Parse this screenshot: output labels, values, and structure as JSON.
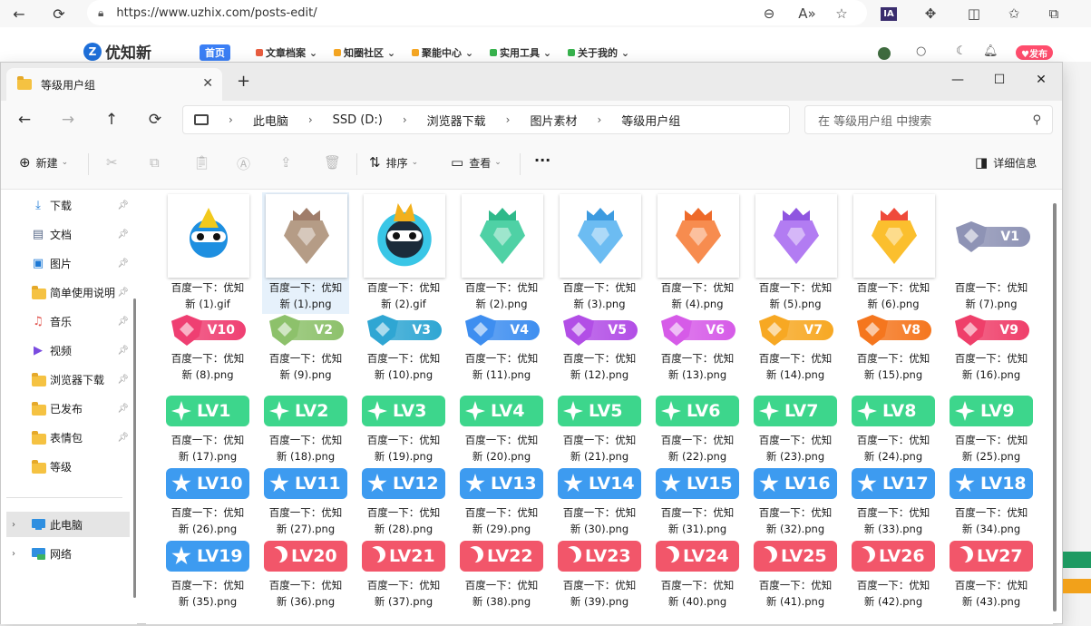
{
  "browser": {
    "url": "https://www.uzhix.com/posts-edit/",
    "buttons": [
      "back-icon",
      "refresh-icon"
    ],
    "right_icons": [
      "zoom-icon",
      "read-aloud-icon",
      "favorite-icon",
      "extension-ia-icon",
      "puzzle-icon",
      "split-screen-icon",
      "favorites-list-icon",
      "collections-icon"
    ]
  },
  "site": {
    "logo": "优知新",
    "logo_mark": "Z",
    "nav": [
      {
        "label": "首页",
        "color": "#3b7ff5"
      },
      {
        "label": "文章档案 ⌄",
        "color": "#e85d3f"
      },
      {
        "label": "知圈社区 ⌄",
        "color": "#f5a623"
      },
      {
        "label": "聚能中心 ⌄",
        "color": "#f5a623"
      },
      {
        "label": "实用工具 ⌄",
        "color": "#37b24d"
      },
      {
        "label": "关于我的 ⌄",
        "color": "#37b24d"
      }
    ],
    "publish": "♥发布"
  },
  "explorer": {
    "tab_title": "等级用户组",
    "tab_add": "+",
    "window_buttons": {
      "min": "—",
      "max": "☐",
      "close": "✕"
    },
    "breadcrumb": [
      "此电脑",
      "SSD (D:)",
      "浏览器下载",
      "图片素材",
      "等级用户组"
    ],
    "breadcrumb_sep": "›",
    "search_placeholder": "在 等级用户组 中搜索",
    "commands": {
      "new": "新建",
      "sort": "排序",
      "view": "查看",
      "more": "···",
      "details": "详细信息"
    },
    "sidebar": [
      {
        "label": "下载",
        "icon": "download-icon",
        "pinned": true
      },
      {
        "label": "文档",
        "icon": "document-icon",
        "pinned": true
      },
      {
        "label": "图片",
        "icon": "picture-icon",
        "pinned": true
      },
      {
        "label": "简单使用说明",
        "icon": "folder-icon",
        "pinned": true
      },
      {
        "label": "音乐",
        "icon": "music-icon",
        "pinned": true
      },
      {
        "label": "视频",
        "icon": "video-icon",
        "pinned": true
      },
      {
        "label": "浏览器下载",
        "icon": "folder-icon",
        "pinned": true
      },
      {
        "label": "已发布",
        "icon": "folder-icon",
        "pinned": true
      },
      {
        "label": "表情包",
        "icon": "folder-icon",
        "pinned": true
      },
      {
        "label": "等级",
        "icon": "folder-icon",
        "pinned": false
      }
    ],
    "sidebar_tree": [
      {
        "label": "此电脑",
        "icon": "computer-icon",
        "active": true
      },
      {
        "label": "网络",
        "icon": "network-icon",
        "active": false
      }
    ],
    "files": [
      {
        "line1": "百度一下：优知",
        "line2": "新 (1).gif",
        "kind": "mascot-white"
      },
      {
        "line1": "百度一下：优知",
        "line2": "新 (1).png",
        "kind": "crown",
        "color": "#b59c86",
        "crown": "#a07d6a"
      },
      {
        "line1": "百度一下：优知",
        "line2": "新 (2).gif",
        "kind": "mascot-dark"
      },
      {
        "line1": "百度一下：优知",
        "line2": "新 (2).png",
        "kind": "crown",
        "color": "#4fd1a5",
        "crown": "#2fb98a"
      },
      {
        "line1": "百度一下：优知",
        "line2": "新 (3).png",
        "kind": "crown",
        "color": "#6cbcf2",
        "crown": "#3d9be0"
      },
      {
        "line1": "百度一下：优知",
        "line2": "新 (4).png",
        "kind": "crown",
        "color": "#f78c4f",
        "crown": "#ee6a2a"
      },
      {
        "line1": "百度一下：优知",
        "line2": "新 (5).png",
        "kind": "crown",
        "color": "#b27cf2",
        "crown": "#8f55e0"
      },
      {
        "line1": "百度一下：优知",
        "line2": "新 (6).png",
        "kind": "crown",
        "color": "#fbbf2e",
        "crown": "#ef4a3a"
      },
      {
        "line1": "百度一下：优知",
        "line2": "新 (7).png",
        "kind": "v",
        "text": "V1",
        "color": "#8e93b5"
      },
      {
        "line1": "百度一下：优知",
        "line2": "新 (8).png",
        "kind": "v",
        "text": "V10",
        "color": "#ef3f72"
      },
      {
        "line1": "百度一下：优知",
        "line2": "新 (9).png",
        "kind": "v",
        "text": "V2",
        "color": "#8dc16b"
      },
      {
        "line1": "百度一下：优知",
        "line2": "新 (10).png",
        "kind": "v",
        "text": "V3",
        "color": "#2fa6d3"
      },
      {
        "line1": "百度一下：优知",
        "line2": "新 (11).png",
        "kind": "v",
        "text": "V4",
        "color": "#3e8ef0"
      },
      {
        "line1": "百度一下：优知",
        "line2": "新 (12).png",
        "kind": "v",
        "text": "V5",
        "color": "#b24ee6"
      },
      {
        "line1": "百度一下：优知",
        "line2": "新 (13).png",
        "kind": "v",
        "text": "V6",
        "color": "#d65be8"
      },
      {
        "line1": "百度一下：优知",
        "line2": "新 (14).png",
        "kind": "v",
        "text": "V7",
        "color": "#f7a823"
      },
      {
        "line1": "百度一下：优知",
        "line2": "新 (15).png",
        "kind": "v",
        "text": "V8",
        "color": "#f5761e"
      },
      {
        "line1": "百度一下：优知",
        "line2": "新 (16).png",
        "kind": "v",
        "text": "V9",
        "color": "#ef3f6a"
      },
      {
        "line1": "百度一下：优知",
        "line2": "新 (17).png",
        "kind": "lv",
        "text": "LV1",
        "color": "#3dd68c",
        "icon": "star4"
      },
      {
        "line1": "百度一下：优知",
        "line2": "新 (18).png",
        "kind": "lv",
        "text": "LV2",
        "color": "#3dd68c",
        "icon": "star4"
      },
      {
        "line1": "百度一下：优知",
        "line2": "新 (19).png",
        "kind": "lv",
        "text": "LV3",
        "color": "#3dd68c",
        "icon": "star4"
      },
      {
        "line1": "百度一下：优知",
        "line2": "新 (20).png",
        "kind": "lv",
        "text": "LV4",
        "color": "#3dd68c",
        "icon": "star4"
      },
      {
        "line1": "百度一下：优知",
        "line2": "新 (21).png",
        "kind": "lv",
        "text": "LV5",
        "color": "#3dd68c",
        "icon": "star4"
      },
      {
        "line1": "百度一下：优知",
        "line2": "新 (22).png",
        "kind": "lv",
        "text": "LV6",
        "color": "#3dd68c",
        "icon": "star4"
      },
      {
        "line1": "百度一下：优知",
        "line2": "新 (23).png",
        "kind": "lv",
        "text": "LV7",
        "color": "#3dd68c",
        "icon": "star4"
      },
      {
        "line1": "百度一下：优知",
        "line2": "新 (24).png",
        "kind": "lv",
        "text": "LV8",
        "color": "#3dd68c",
        "icon": "star4"
      },
      {
        "line1": "百度一下：优知",
        "line2": "新 (25).png",
        "kind": "lv",
        "text": "LV9",
        "color": "#3dd68c",
        "icon": "star4"
      },
      {
        "line1": "百度一下：优知",
        "line2": "新 (26).png",
        "kind": "lv",
        "text": "LV10",
        "color": "#3d9bf0",
        "icon": "star5"
      },
      {
        "line1": "百度一下：优知",
        "line2": "新 (27).png",
        "kind": "lv",
        "text": "LV11",
        "color": "#3d9bf0",
        "icon": "star5"
      },
      {
        "line1": "百度一下：优知",
        "line2": "新 (28).png",
        "kind": "lv",
        "text": "LV12",
        "color": "#3d9bf0",
        "icon": "star5"
      },
      {
        "line1": "百度一下：优知",
        "line2": "新 (29).png",
        "kind": "lv",
        "text": "LV13",
        "color": "#3d9bf0",
        "icon": "star5"
      },
      {
        "line1": "百度一下：优知",
        "line2": "新 (30).png",
        "kind": "lv",
        "text": "LV14",
        "color": "#3d9bf0",
        "icon": "star5"
      },
      {
        "line1": "百度一下：优知",
        "line2": "新 (31).png",
        "kind": "lv",
        "text": "LV15",
        "color": "#3d9bf0",
        "icon": "star5"
      },
      {
        "line1": "百度一下：优知",
        "line2": "新 (32).png",
        "kind": "lv",
        "text": "LV16",
        "color": "#3d9bf0",
        "icon": "star5"
      },
      {
        "line1": "百度一下：优知",
        "line2": "新 (33).png",
        "kind": "lv",
        "text": "LV17",
        "color": "#3d9bf0",
        "icon": "star5"
      },
      {
        "line1": "百度一下：优知",
        "line2": "新 (34).png",
        "kind": "lv",
        "text": "LV18",
        "color": "#3d9bf0",
        "icon": "star5"
      },
      {
        "line1": "百度一下：优知",
        "line2": "新 (35).png",
        "kind": "lv",
        "text": "LV19",
        "color": "#3d9bf0",
        "icon": "star5"
      },
      {
        "line1": "百度一下：优知",
        "line2": "新 (36).png",
        "kind": "lv",
        "text": "LV20",
        "color": "#f2566a",
        "icon": "moon"
      },
      {
        "line1": "百度一下：优知",
        "line2": "新 (37).png",
        "kind": "lv",
        "text": "LV21",
        "color": "#f2566a",
        "icon": "moon"
      },
      {
        "line1": "百度一下：优知",
        "line2": "新 (38).png",
        "kind": "lv",
        "text": "LV22",
        "color": "#f2566a",
        "icon": "moon"
      },
      {
        "line1": "百度一下：优知",
        "line2": "新 (39).png",
        "kind": "lv",
        "text": "LV23",
        "color": "#f2566a",
        "icon": "moon"
      },
      {
        "line1": "百度一下：优知",
        "line2": "新 (40).png",
        "kind": "lv",
        "text": "LV24",
        "color": "#f2566a",
        "icon": "moon"
      },
      {
        "line1": "百度一下：优知",
        "line2": "新 (41).png",
        "kind": "lv",
        "text": "LV25",
        "color": "#f2566a",
        "icon": "moon"
      },
      {
        "line1": "百度一下：优知",
        "line2": "新 (42).png",
        "kind": "lv",
        "text": "LV26",
        "color": "#f2566a",
        "icon": "moon"
      },
      {
        "line1": "百度一下：优知",
        "line2": "新 (43).png",
        "kind": "lv",
        "text": "LV27",
        "color": "#f2566a",
        "icon": "moon"
      }
    ],
    "selected_file_index": 1
  }
}
